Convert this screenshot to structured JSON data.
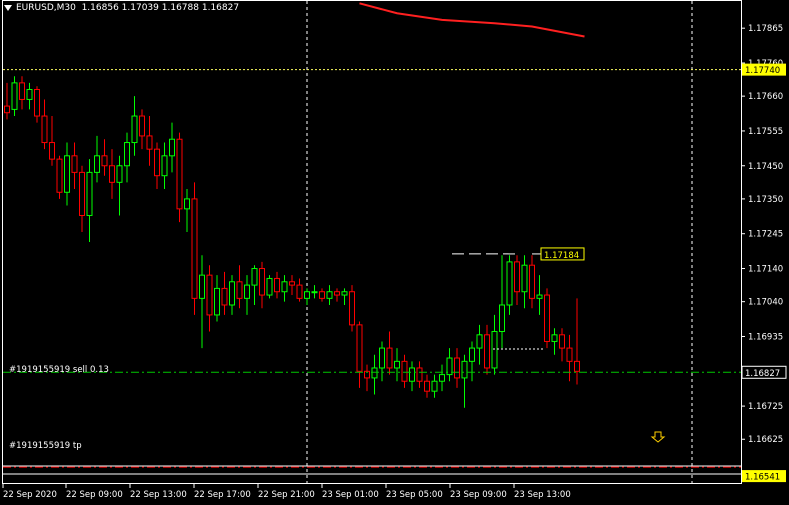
{
  "header": {
    "symbol_timeframe": "EURUSD,M30",
    "open": "1.16856",
    "high": "1.17039",
    "low": "1.16788",
    "close": "1.16827"
  },
  "price_axis": {
    "labels": [
      "1.17865",
      "1.17760",
      "1.17660",
      "1.17555",
      "1.17450",
      "1.17350",
      "1.17245",
      "1.17140",
      "1.17040",
      "1.16935",
      "1.16830",
      "1.16725",
      "1.16625",
      "1.16520"
    ],
    "crosshair_price": "1.17740",
    "current_price": "1.16827",
    "tp_price": "1.16541"
  },
  "time_axis": {
    "labels": [
      "22 Sep 2020",
      "22 Sep 09:00",
      "22 Sep 13:00",
      "22 Sep 17:00",
      "22 Sep 21:00",
      "23 Sep 01:00",
      "23 Sep 05:00",
      "23 Sep 09:00",
      "23 Sep 13:00"
    ]
  },
  "orders": {
    "sell_label": "#1919155919 sell 0.13",
    "tp_label": "#1919155919 tp"
  },
  "annotation": {
    "price_tag": "1.17184"
  },
  "colors": {
    "bull": "#00ff00",
    "bear": "#ff0000",
    "ma_line": "#ff2020",
    "crosshair": "#ffffff",
    "order_line": "#00c800",
    "tp_line": "#ff0000",
    "price_tag_bg": "#ffff00",
    "arrow": "#ffd000"
  },
  "chart_data": {
    "type": "candlestick",
    "symbol": "EURUSD",
    "timeframe": "M30",
    "candles": [
      {
        "o": 1.1763,
        "h": 1.177,
        "l": 1.1759,
        "c": 1.1761
      },
      {
        "o": 1.1762,
        "h": 1.1772,
        "l": 1.176,
        "c": 1.177
      },
      {
        "o": 1.177,
        "h": 1.1772,
        "l": 1.1762,
        "c": 1.1765
      },
      {
        "o": 1.1765,
        "h": 1.177,
        "l": 1.1762,
        "c": 1.1768
      },
      {
        "o": 1.1768,
        "h": 1.1769,
        "l": 1.1758,
        "c": 1.176
      },
      {
        "o": 1.176,
        "h": 1.1765,
        "l": 1.175,
        "c": 1.1752
      },
      {
        "o": 1.1752,
        "h": 1.176,
        "l": 1.1745,
        "c": 1.1747
      },
      {
        "o": 1.1747,
        "h": 1.1748,
        "l": 1.1735,
        "c": 1.1737
      },
      {
        "o": 1.1737,
        "h": 1.1752,
        "l": 1.1733,
        "c": 1.1748
      },
      {
        "o": 1.1748,
        "h": 1.1752,
        "l": 1.1738,
        "c": 1.1743
      },
      {
        "o": 1.1743,
        "h": 1.1745,
        "l": 1.1725,
        "c": 1.173
      },
      {
        "o": 1.173,
        "h": 1.1747,
        "l": 1.1722,
        "c": 1.1743
      },
      {
        "o": 1.1743,
        "h": 1.1754,
        "l": 1.174,
        "c": 1.1748
      },
      {
        "o": 1.1748,
        "h": 1.1753,
        "l": 1.1742,
        "c": 1.1745
      },
      {
        "o": 1.1745,
        "h": 1.175,
        "l": 1.1735,
        "c": 1.174
      },
      {
        "o": 1.174,
        "h": 1.1748,
        "l": 1.173,
        "c": 1.1745
      },
      {
        "o": 1.1745,
        "h": 1.1755,
        "l": 1.174,
        "c": 1.1752
      },
      {
        "o": 1.1752,
        "h": 1.1766,
        "l": 1.1748,
        "c": 1.176
      },
      {
        "o": 1.176,
        "h": 1.1762,
        "l": 1.175,
        "c": 1.1754
      },
      {
        "o": 1.1754,
        "h": 1.176,
        "l": 1.1745,
        "c": 1.175
      },
      {
        "o": 1.175,
        "h": 1.1752,
        "l": 1.1738,
        "c": 1.1742
      },
      {
        "o": 1.1742,
        "h": 1.1752,
        "l": 1.1738,
        "c": 1.1748
      },
      {
        "o": 1.1748,
        "h": 1.1758,
        "l": 1.1743,
        "c": 1.1753
      },
      {
        "o": 1.1753,
        "h": 1.1755,
        "l": 1.1728,
        "c": 1.1732
      },
      {
        "o": 1.1732,
        "h": 1.1738,
        "l": 1.1725,
        "c": 1.1735
      },
      {
        "o": 1.1735,
        "h": 1.174,
        "l": 1.17,
        "c": 1.1705
      },
      {
        "o": 1.1705,
        "h": 1.1718,
        "l": 1.169,
        "c": 1.1712
      },
      {
        "o": 1.1712,
        "h": 1.1715,
        "l": 1.1695,
        "c": 1.17
      },
      {
        "o": 1.17,
        "h": 1.1712,
        "l": 1.1698,
        "c": 1.1708
      },
      {
        "o": 1.1708,
        "h": 1.1713,
        "l": 1.17,
        "c": 1.1703
      },
      {
        "o": 1.1703,
        "h": 1.1712,
        "l": 1.17,
        "c": 1.171
      },
      {
        "o": 1.171,
        "h": 1.1715,
        "l": 1.1702,
        "c": 1.1705
      },
      {
        "o": 1.1705,
        "h": 1.1712,
        "l": 1.17,
        "c": 1.1709
      },
      {
        "o": 1.1709,
        "h": 1.1715,
        "l": 1.1703,
        "c": 1.1714
      },
      {
        "o": 1.1714,
        "h": 1.1716,
        "l": 1.1702,
        "c": 1.1706
      },
      {
        "o": 1.1706,
        "h": 1.1712,
        "l": 1.1705,
        "c": 1.1711
      },
      {
        "o": 1.1711,
        "h": 1.1713,
        "l": 1.1705,
        "c": 1.1707
      },
      {
        "o": 1.1707,
        "h": 1.1712,
        "l": 1.1704,
        "c": 1.171
      },
      {
        "o": 1.171,
        "h": 1.1712,
        "l": 1.1706,
        "c": 1.1709
      },
      {
        "o": 1.1709,
        "h": 1.1711,
        "l": 1.1704,
        "c": 1.1705
      },
      {
        "o": 1.1705,
        "h": 1.1708,
        "l": 1.1703,
        "c": 1.1707
      },
      {
        "o": 1.1707,
        "h": 1.1709,
        "l": 1.1705,
        "c": 1.1707
      },
      {
        "o": 1.1707,
        "h": 1.1708,
        "l": 1.1704,
        "c": 1.1705
      },
      {
        "o": 1.1705,
        "h": 1.1709,
        "l": 1.1703,
        "c": 1.1707
      },
      {
        "o": 1.1707,
        "h": 1.1708,
        "l": 1.1704,
        "c": 1.1706
      },
      {
        "o": 1.1706,
        "h": 1.1708,
        "l": 1.1703,
        "c": 1.1707
      },
      {
        "o": 1.1707,
        "h": 1.1709,
        "l": 1.1695,
        "c": 1.1697
      },
      {
        "o": 1.1697,
        "h": 1.1698,
        "l": 1.1678,
        "c": 1.1683
      },
      {
        "o": 1.1683,
        "h": 1.1685,
        "l": 1.1677,
        "c": 1.1681
      },
      {
        "o": 1.1681,
        "h": 1.1688,
        "l": 1.1676,
        "c": 1.1684
      },
      {
        "o": 1.1684,
        "h": 1.1692,
        "l": 1.168,
        "c": 1.169
      },
      {
        "o": 1.169,
        "h": 1.1695,
        "l": 1.1682,
        "c": 1.1684
      },
      {
        "o": 1.1684,
        "h": 1.169,
        "l": 1.168,
        "c": 1.1686
      },
      {
        "o": 1.1686,
        "h": 1.1688,
        "l": 1.1678,
        "c": 1.168
      },
      {
        "o": 1.168,
        "h": 1.1686,
        "l": 1.1677,
        "c": 1.1684
      },
      {
        "o": 1.1684,
        "h": 1.1686,
        "l": 1.1678,
        "c": 1.168
      },
      {
        "o": 1.168,
        "h": 1.1682,
        "l": 1.1675,
        "c": 1.1677
      },
      {
        "o": 1.1677,
        "h": 1.1682,
        "l": 1.1675,
        "c": 1.168
      },
      {
        "o": 1.168,
        "h": 1.1685,
        "l": 1.1677,
        "c": 1.1682
      },
      {
        "o": 1.1682,
        "h": 1.169,
        "l": 1.168,
        "c": 1.1687
      },
      {
        "o": 1.1687,
        "h": 1.169,
        "l": 1.1678,
        "c": 1.1681
      },
      {
        "o": 1.1681,
        "h": 1.1688,
        "l": 1.1672,
        "c": 1.1686
      },
      {
        "o": 1.1686,
        "h": 1.1692,
        "l": 1.168,
        "c": 1.169
      },
      {
        "o": 1.169,
        "h": 1.1697,
        "l": 1.1685,
        "c": 1.1694
      },
      {
        "o": 1.1694,
        "h": 1.1697,
        "l": 1.1682,
        "c": 1.1684
      },
      {
        "o": 1.1684,
        "h": 1.17,
        "l": 1.1682,
        "c": 1.1695
      },
      {
        "o": 1.1695,
        "h": 1.1718,
        "l": 1.169,
        "c": 1.1703
      },
      {
        "o": 1.1703,
        "h": 1.1718,
        "l": 1.17,
        "c": 1.1716
      },
      {
        "o": 1.1716,
        "h": 1.1718,
        "l": 1.1703,
        "c": 1.1707
      },
      {
        "o": 1.1707,
        "h": 1.1718,
        "l": 1.1702,
        "c": 1.1715
      },
      {
        "o": 1.1715,
        "h": 1.1718,
        "l": 1.1702,
        "c": 1.1705
      },
      {
        "o": 1.1705,
        "h": 1.1712,
        "l": 1.17,
        "c": 1.1706
      },
      {
        "o": 1.1706,
        "h": 1.1708,
        "l": 1.169,
        "c": 1.1692
      },
      {
        "o": 1.1692,
        "h": 1.1696,
        "l": 1.1688,
        "c": 1.1694
      },
      {
        "o": 1.1694,
        "h": 1.1696,
        "l": 1.1686,
        "c": 1.169
      },
      {
        "o": 1.169,
        "h": 1.1694,
        "l": 1.168,
        "c": 1.1686
      },
      {
        "o": 1.1686,
        "h": 1.1705,
        "l": 1.1679,
        "c": 1.1683
      }
    ],
    "moving_average": [
      {
        "index": 47,
        "price": 1.1794
      },
      {
        "index": 52,
        "price": 1.1791
      },
      {
        "index": 58,
        "price": 1.1789
      },
      {
        "index": 65,
        "price": 1.1788
      },
      {
        "index": 70,
        "price": 1.1787
      },
      {
        "index": 77,
        "price": 1.1784
      }
    ],
    "order_sell_price": 1.16827,
    "tp_price": 1.16541,
    "crosshair_price": 1.1774,
    "annotation_price": 1.17184,
    "y_range": [
      1.1649,
      1.1795
    ]
  }
}
